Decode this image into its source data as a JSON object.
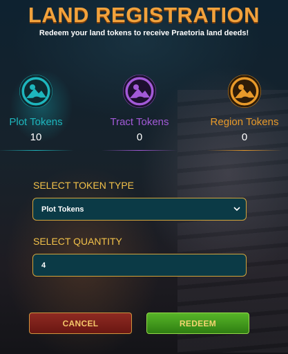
{
  "header": {
    "title": "LAND REGISTRATION",
    "subtitle": "Redeem your land tokens to receive Praetoria land deeds!"
  },
  "tokens": [
    {
      "label": "Plot Tokens",
      "count": "10",
      "icon": "plot-token-icon",
      "color": "#1eb6bd"
    },
    {
      "label": "Tract Tokens",
      "count": "0",
      "icon": "tract-token-icon",
      "color": "#a35ad8"
    },
    {
      "label": "Region Tokens",
      "count": "0",
      "icon": "region-token-icon",
      "color": "#e89a2a"
    }
  ],
  "form": {
    "token_type_label": "SELECT TOKEN TYPE",
    "token_type_value": "Plot Tokens",
    "quantity_label": "SELECT QUANTITY",
    "quantity_value": "4"
  },
  "actions": {
    "cancel_label": "CANCEL",
    "redeem_label": "REDEEM"
  },
  "colors": {
    "title": "#f2a23c",
    "label": "#f3c24a",
    "field_bg": "#0b3a46",
    "field_border": "#d4a53c"
  }
}
